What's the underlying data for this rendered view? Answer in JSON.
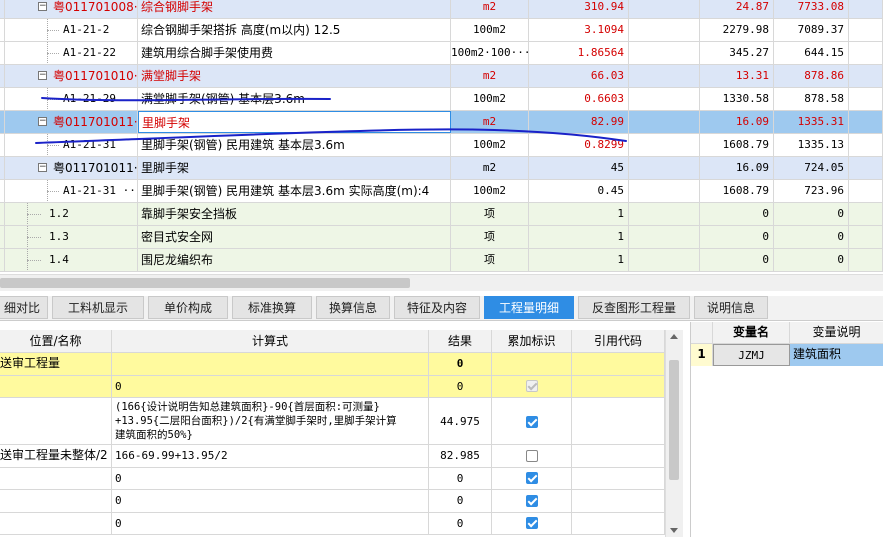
{
  "colors": {
    "red_text": "#d40000",
    "row_blue": "#dce6f7",
    "row_selected": "#9ec9ef",
    "tab_active": "#2f8de4",
    "highlight_yellow": "#fffa9e",
    "annotation_ink": "#1a22c8"
  },
  "top_grid": {
    "rows": [
      {
        "style": "blue",
        "code": "粤011701008···",
        "name": "综合钢脚手架",
        "unit": "m2",
        "qty": "310.94",
        "price": "24.87",
        "total": "7733.08",
        "red": true,
        "expander": "−",
        "level": 1
      },
      {
        "style": "white",
        "code": "A1-21-2",
        "name": "综合钢脚手架搭拆 高度(m以内) 12.5",
        "unit": "100m2",
        "qty": "3.1094",
        "price": "2279.98",
        "total": "7089.37",
        "red_qty": true,
        "level": 2
      },
      {
        "style": "white",
        "code": "A1-21-22",
        "name": "建筑用综合脚手架使用费",
        "unit": "100m2·100···",
        "qty": "1.86564",
        "price": "345.27",
        "total": "644.15",
        "red_qty": true,
        "level": 2
      },
      {
        "style": "blue",
        "code": "粤011701010···",
        "name": "满堂脚手架",
        "unit": "m2",
        "qty": "66.03",
        "price": "13.31",
        "total": "878.86",
        "red": true,
        "expander": "−",
        "level": 1
      },
      {
        "style": "white",
        "code": "A1-21-29",
        "name": "满堂脚手架(钢管) 基本层3.6m",
        "unit": "100m2",
        "qty": "0.6603",
        "price": "1330.58",
        "total": "878.58",
        "red_qty": true,
        "level": 2
      },
      {
        "style": "selected",
        "code": "粤011701011···",
        "name": "里脚手架",
        "unit": "m2",
        "qty": "82.99",
        "price": "16.09",
        "total": "1335.31",
        "red": true,
        "expander": "−",
        "level": 1
      },
      {
        "style": "white",
        "code": "A1-21-31",
        "name": "里脚手架(钢管) 民用建筑 基本层3.6m",
        "unit": "100m2",
        "qty": "0.8299",
        "price": "1608.79",
        "total": "1335.13",
        "red_qty": true,
        "level": 2
      },
      {
        "style": "blue",
        "code": "粤011701011···",
        "name": "里脚手架",
        "unit": "m2",
        "qty": "45",
        "price": "16.09",
        "total": "724.05",
        "expander": "−",
        "level": 1
      },
      {
        "style": "white",
        "code": "A1-21-31 ···",
        "name": "里脚手架(钢管) 民用建筑 基本层3.6m  实际高度(m):4",
        "unit": "100m2",
        "qty": "0.45",
        "price": "1608.79",
        "total": "723.96",
        "level": 2
      },
      {
        "style": "green",
        "code": "1.2",
        "name": "靠脚手架安全挡板",
        "unit": "项",
        "qty": "1",
        "price": "0",
        "total": "0",
        "level": 0
      },
      {
        "style": "green",
        "code": "1.3",
        "name": "密目式安全网",
        "unit": "项",
        "qty": "1",
        "price": "0",
        "total": "0",
        "level": 0
      },
      {
        "style": "green",
        "code": "1.4",
        "name": "围尼龙编织布",
        "unit": "项",
        "qty": "1",
        "price": "0",
        "total": "0",
        "level": 0
      }
    ]
  },
  "tabs": [
    {
      "label": "细对比"
    },
    {
      "label": "工料机显示"
    },
    {
      "label": "单价构成"
    },
    {
      "label": "标准换算"
    },
    {
      "label": "换算信息"
    },
    {
      "label": "特征及内容"
    },
    {
      "label": "工程量明细",
      "active": true
    },
    {
      "label": "反查图形工程量"
    },
    {
      "label": "说明信息"
    }
  ],
  "detail_grid": {
    "headers": {
      "name": "位置/名称",
      "formula": "计算式",
      "result": "结果",
      "accum": "累加标识",
      "ref": "引用代码"
    },
    "rows": [
      {
        "name": "送审工程量",
        "formula": "",
        "result": "0",
        "check": "none",
        "yellow": true,
        "bold_result": true
      },
      {
        "name": "",
        "formula": "0",
        "result": "0",
        "check": "disabled",
        "yellow": true
      },
      {
        "name": "",
        "formula": "(166{设计说明告知总建筑面积}-90{首层面积:可测量}+13.95{二层阳台面积})/2{有满堂脚手架时,里脚手架计算建筑面积的50%}",
        "formula_lines": [
          "(166{设计说明告知总建筑面积}-90{首层面积:可测量}",
          "+13.95{二层阳台面积})/2{有满堂脚手架时,里脚手架计算",
          "建筑面积的50%}"
        ],
        "result": "44.975",
        "check": "on",
        "tall": true
      },
      {
        "name": "送审工程量未整体/2",
        "formula": "166-69.99+13.95/2",
        "result": "82.985",
        "check": "off"
      },
      {
        "name": "",
        "formula": "0",
        "result": "0",
        "check": "on"
      },
      {
        "name": "",
        "formula": "0",
        "result": "0",
        "check": "on"
      },
      {
        "name": "",
        "formula": "0",
        "result": "0",
        "check": "on"
      }
    ]
  },
  "var_grid": {
    "headers": {
      "name": "变量名",
      "desc": "变量说明"
    },
    "rows": [
      {
        "index": "1",
        "name": "JZMJ",
        "desc": "建筑面积"
      }
    ]
  }
}
